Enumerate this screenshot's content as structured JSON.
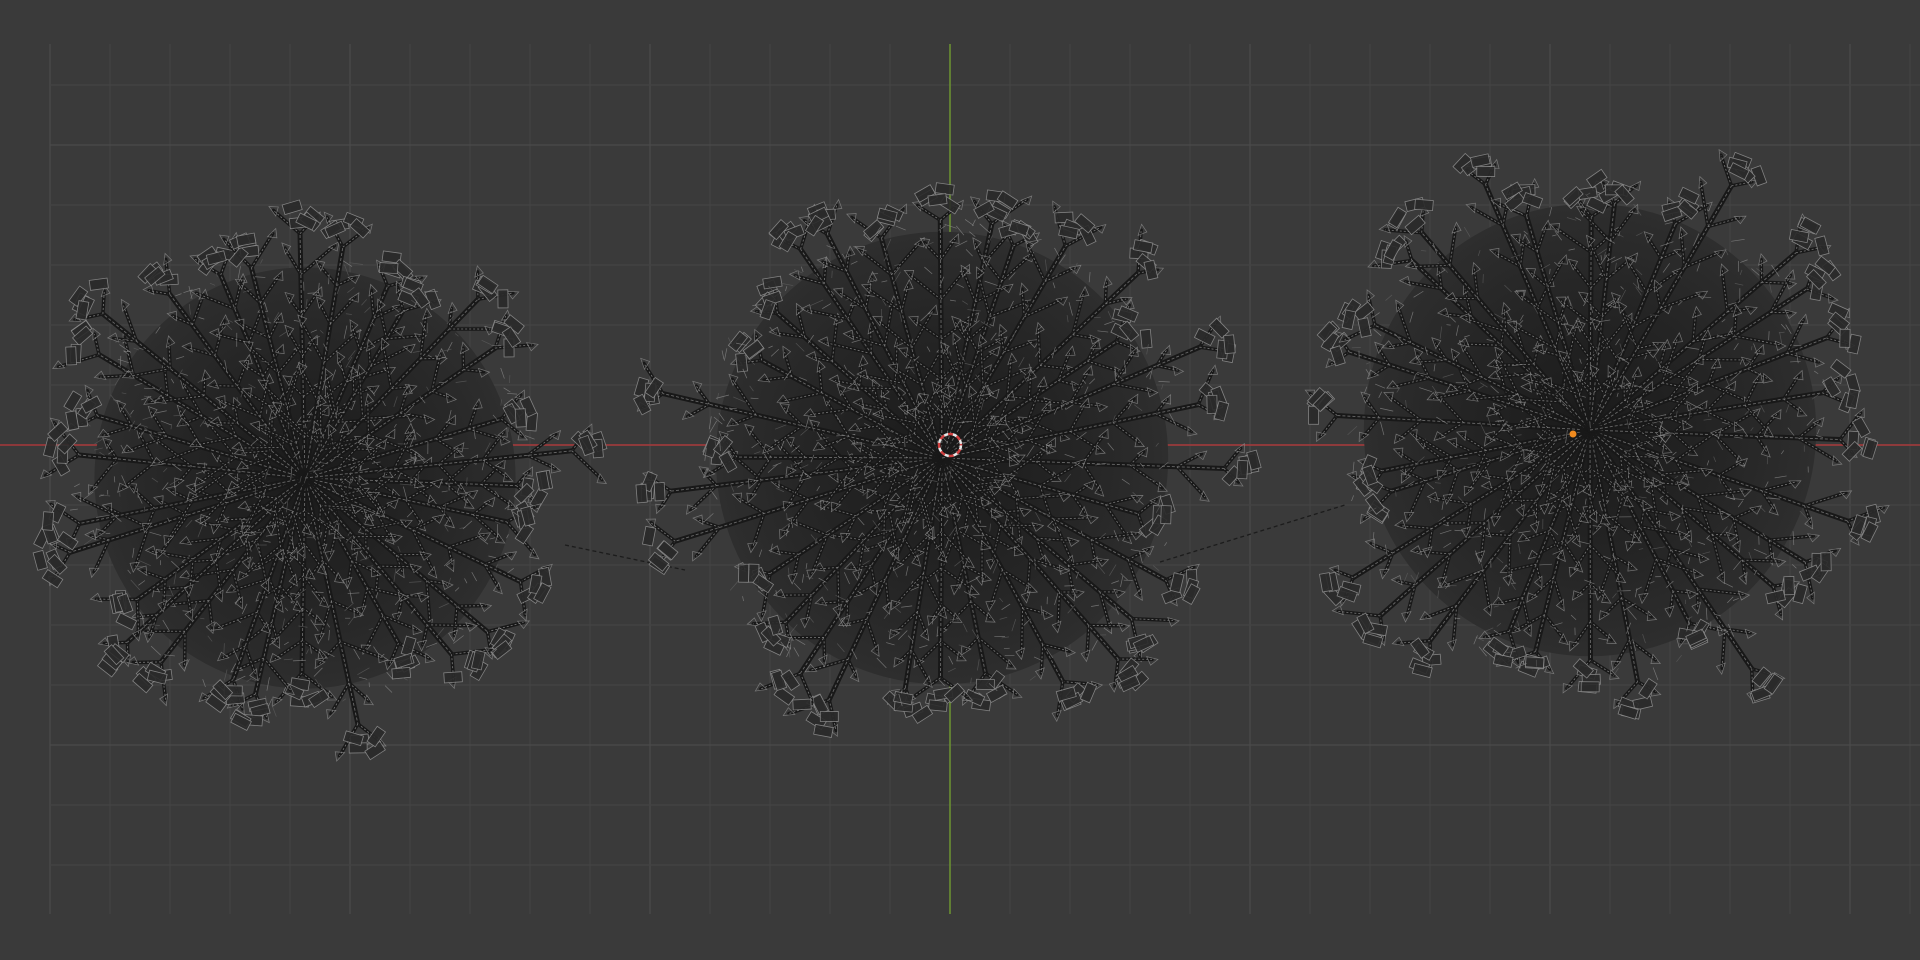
{
  "editor": "3d-viewport",
  "view": {
    "orientation": "top",
    "shading": "wireframe",
    "grid_visible": true
  },
  "axes": {
    "x_axis_color": "#a8383a",
    "y_axis_color": "#6c9430"
  },
  "colors": {
    "background": "#3a3a3a",
    "grid_minor": "#434343",
    "grid_major": "#4b4b4b",
    "wire_dark": "#181818",
    "wire_light": "#8a8a8a",
    "cursor_ring": "#e8e8e8",
    "cursor_accent": "#d04040",
    "selected_origin": "#f08a1e"
  },
  "scene": {
    "objects": [
      {
        "id": "tree-left",
        "kind": "tree-mesh",
        "selected": false
      },
      {
        "id": "tree-center",
        "kind": "tree-mesh",
        "selected": false
      },
      {
        "id": "tree-right",
        "kind": "tree-mesh",
        "selected": true
      }
    ],
    "relationship_lines": 2,
    "cursor_3d": "world-origin"
  }
}
